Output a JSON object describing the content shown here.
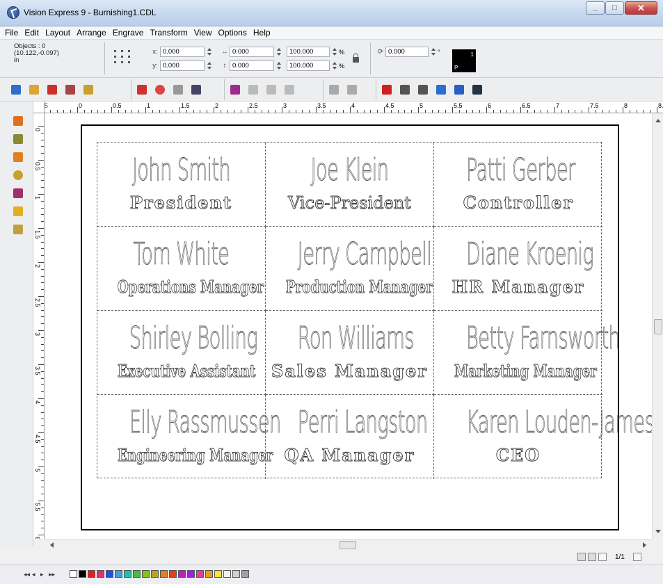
{
  "window": {
    "title": "Vision Express 9 - Burnishing1.CDL",
    "minimize_icon": "minimize-icon",
    "maximize_icon": "maximize-icon",
    "close_icon": "close-icon"
  },
  "menu": [
    "File",
    "Edit",
    "Layout",
    "Arrange",
    "Engrave",
    "Transform",
    "View",
    "Options",
    "Help"
  ],
  "properties": {
    "objects": "Objects : 0",
    "coords": "(10.122,-0.097)",
    "units": "in",
    "x_label": "x:",
    "x_value": "0.000",
    "y_label": "y:",
    "y_value": "0.000",
    "w_value": "0.000",
    "h_value": "0.000",
    "scale_x": "100.000",
    "scale_y": "100.000",
    "pct": "%",
    "rotation": "0.000",
    "degree": "°",
    "swatch_p": "P",
    "swatch_n": "1"
  },
  "ruler": {
    "top_labels": [
      "5",
      "0",
      "0.5",
      "1",
      "1.5",
      "2",
      "2.5",
      "3",
      "3.5",
      "4",
      "4.5",
      "5",
      "5.5",
      "6",
      "6.5",
      "7",
      "7.5",
      "8",
      "8.5"
    ],
    "left_labels": [
      "0",
      "0.5",
      "1",
      "1.5",
      "2",
      "2.5",
      "3",
      "3.5",
      "4",
      "4.5",
      "5",
      "5.5",
      "6"
    ]
  },
  "badges": [
    {
      "name": "John Smith",
      "title": "President",
      "style": "wide"
    },
    {
      "name": "Joe Klein",
      "title": "Vice-President",
      "style": "normal"
    },
    {
      "name": "Patti Gerber",
      "title": "Controller",
      "style": "wide"
    },
    {
      "name": "Tom White",
      "title": "Operations Manager",
      "style": "condensed"
    },
    {
      "name": "Jerry Campbell",
      "title": "Production Manager",
      "style": "condensed"
    },
    {
      "name": "Diane Kroenig",
      "title": "HR Manager",
      "style": "wide"
    },
    {
      "name": "Shirley Bolling",
      "title": "Executive Assistant",
      "style": "condensed"
    },
    {
      "name": "Ron Williams",
      "title": "Sales Manager",
      "style": "wide"
    },
    {
      "name": "Betty Farnsworth",
      "title": "Marketing Manager",
      "style": "condensed"
    },
    {
      "name": "Elly Rassmussen",
      "title": "Engineering Manager",
      "style": "condensed"
    },
    {
      "name": "Perri Langston",
      "title": "QA Manager",
      "style": "wide"
    },
    {
      "name": "Karen Louden-James",
      "title": "CEO",
      "style": "wide"
    }
  ],
  "pagenav": {
    "page": "1/1"
  },
  "colors": {
    "palette": [
      "#ffffff",
      "#000000",
      "#e02020",
      "#e03070",
      "#2050e0",
      "#40a0e0",
      "#20c0b0",
      "#40c040",
      "#80c020",
      "#c0a020",
      "#e08020",
      "#e04020",
      "#c020c0",
      "#a020e0",
      "#e040a0",
      "#e0a020",
      "#ffe040",
      "#f0f0f0",
      "#d0d0d0",
      "#a0a0a0"
    ]
  }
}
